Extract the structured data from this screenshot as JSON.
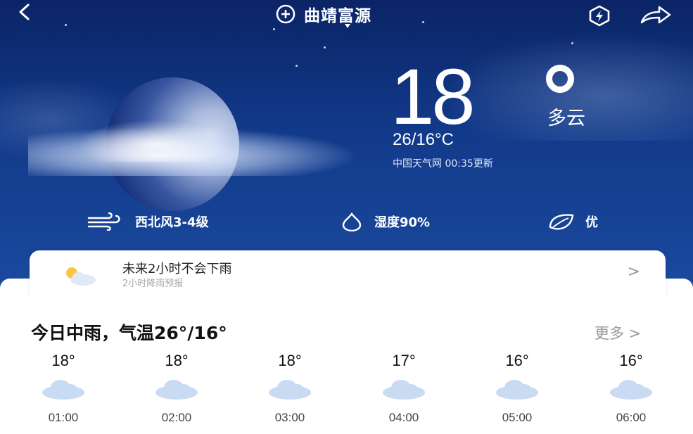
{
  "header": {
    "location": "曲靖富源",
    "icons": {
      "back": "chevron-left-icon",
      "add_location": "add-location-icon",
      "theme": "hexagon-bolt-icon",
      "share": "share-arrow-icon"
    }
  },
  "current": {
    "temperature": "18",
    "condition": "多云",
    "range": "26/16°C",
    "source": "中国天气网 00:35更新"
  },
  "metrics": {
    "wind": "西北风3-4级",
    "humidity": "湿度90%",
    "air_quality": "优"
  },
  "rain_forecast": {
    "title": "未来2小时不会下雨",
    "subtitle": "2小时降雨预报",
    "arrow": ">"
  },
  "today": {
    "summary": "今日中雨，气温26°/16°",
    "more": "更多 >"
  },
  "hourly": [
    {
      "temp": "18°",
      "time": "01:00",
      "icon": "cloud-icon"
    },
    {
      "temp": "18°",
      "time": "02:00",
      "icon": "cloud-icon"
    },
    {
      "temp": "18°",
      "time": "03:00",
      "icon": "cloud-icon"
    },
    {
      "temp": "17°",
      "time": "04:00",
      "icon": "cloud-icon"
    },
    {
      "temp": "16°",
      "time": "05:00",
      "icon": "cloud-icon"
    },
    {
      "temp": "16°",
      "time": "06:00",
      "icon": "cloud-icon"
    }
  ],
  "colors": {
    "sky_top": "#0b2466",
    "sky_bottom": "#1b4aa0",
    "card_bg": "#ffffff",
    "cloud_icon": "#c9dbf2"
  }
}
